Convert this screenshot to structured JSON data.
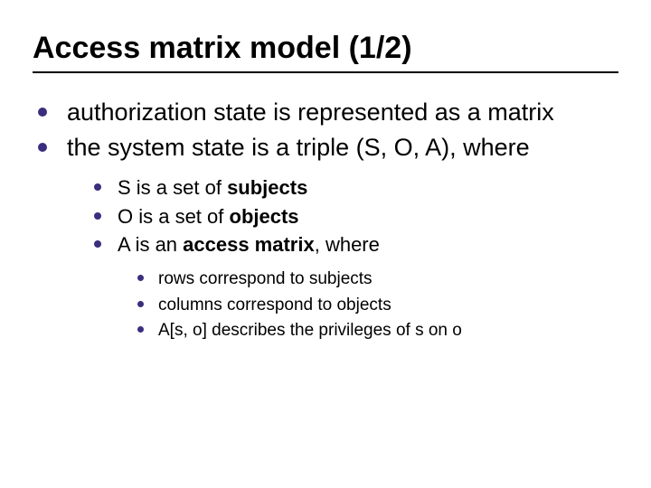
{
  "title": "Access matrix model (1/2)",
  "level1": [
    "authorization state is represented as a matrix",
    "the system state is a triple (S, O, A), where"
  ],
  "level2": [
    {
      "pre": "S is a set of ",
      "bold": "subjects",
      "post": ""
    },
    {
      "pre": "O is a set of ",
      "bold": "objects",
      "post": ""
    },
    {
      "pre": "A is an ",
      "bold": "access matrix",
      "post": ", where"
    }
  ],
  "level3": [
    "rows correspond to subjects",
    "columns correspond to objects",
    "A[s, o] describes the privileges of s on o"
  ]
}
